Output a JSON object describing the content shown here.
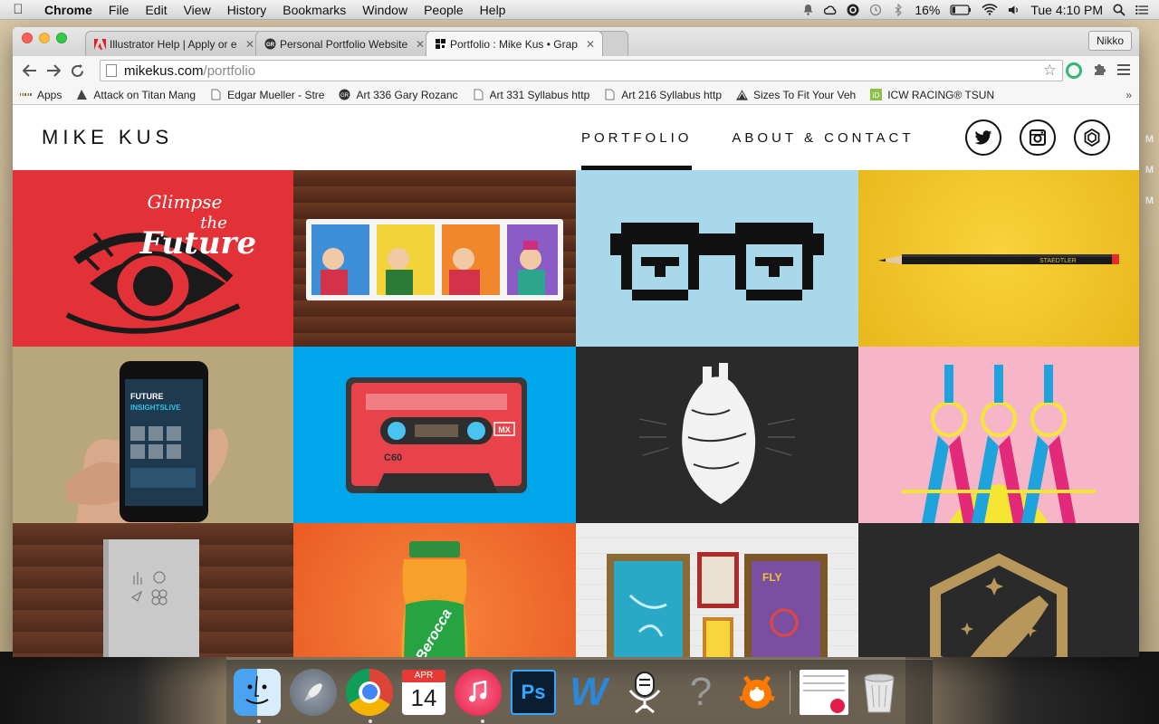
{
  "menubar": {
    "app_name": "Chrome",
    "items": [
      "File",
      "Edit",
      "View",
      "History",
      "Bookmarks",
      "Window",
      "People",
      "Help"
    ],
    "battery": "16%",
    "clock": "Tue 4:10 PM"
  },
  "browser": {
    "tabs": [
      {
        "title": "Illustrator Help | Apply or e",
        "active": false
      },
      {
        "title": "Personal Portfolio Website",
        "active": false
      },
      {
        "title": "Portfolio : Mike Kus • Grap",
        "active": true
      }
    ],
    "profile": "Nikko",
    "url_host": "mikekus.com",
    "url_path": "/portfolio",
    "bookmarks": [
      {
        "label": "Apps",
        "icon": "apps-grid-icon"
      },
      {
        "label": "Attack on Titan Mang",
        "icon": "page-icon"
      },
      {
        "label": "Edgar Mueller - Stre",
        "icon": "page-icon"
      },
      {
        "label": "Art 336 Gary Rozanc",
        "icon": "site-icon"
      },
      {
        "label": "Art 331 Syllabus http",
        "icon": "page-icon"
      },
      {
        "label": "Art 216 Syllabus http",
        "icon": "page-icon"
      },
      {
        "label": "Sizes To Fit Your Veh",
        "icon": "page-icon"
      },
      {
        "label": "ICW RACING® TSUN",
        "icon": "id-icon"
      }
    ],
    "bookmarks_more": "»"
  },
  "site": {
    "logo": "MIKE KUS",
    "nav": [
      {
        "label": "PORTFOLIO",
        "active": true
      },
      {
        "label": "ABOUT & CONTACT",
        "active": false
      }
    ],
    "social_icons": [
      "twitter-icon",
      "instagram-icon",
      "dribbble-icon"
    ]
  },
  "portfolio": {
    "tiles": [
      {
        "name": "glimpse-the-future",
        "bg": "#e23238",
        "text_1": "Glimpse",
        "text_2": "the",
        "text_3": "Future"
      },
      {
        "name": "stamps",
        "bg": "#5a2e1c"
      },
      {
        "name": "pixel-glasses",
        "bg": "#a8d8ea"
      },
      {
        "name": "staedtler-pencil",
        "bg": "#f4c52a",
        "text": "STAEDTLER"
      },
      {
        "name": "future-insights-phone",
        "bg": "#b8a77a",
        "text_1": "FUTURE",
        "text_2": "INSIGHTSLIVE"
      },
      {
        "name": "cassette-tape",
        "bg": "#00a6ec",
        "text_1": "C60",
        "text_2": "MX"
      },
      {
        "name": "typographic-heart",
        "bg": "#2a2a2a"
      },
      {
        "name": "compasses",
        "bg": "#f7b6c8"
      },
      {
        "name": "book-on-wood",
        "bg": "#5b3322"
      },
      {
        "name": "berocca-bottle",
        "bg": "#f36b2a",
        "text": "Berocca"
      },
      {
        "name": "framed-prints",
        "bg": "#e9e9e9",
        "text": "FLY"
      },
      {
        "name": "rocket-badge",
        "bg": "#2a2a2a"
      }
    ]
  },
  "dock": {
    "apps": [
      "Finder",
      "Launchpad",
      "Google Chrome",
      "Calendar",
      "iTunes",
      "Photoshop",
      "Wunderlist",
      "Voice App",
      "Unknown App",
      "Avast",
      "Documents",
      "Trash"
    ],
    "calendar_month": "APR",
    "calendar_day": "14"
  }
}
